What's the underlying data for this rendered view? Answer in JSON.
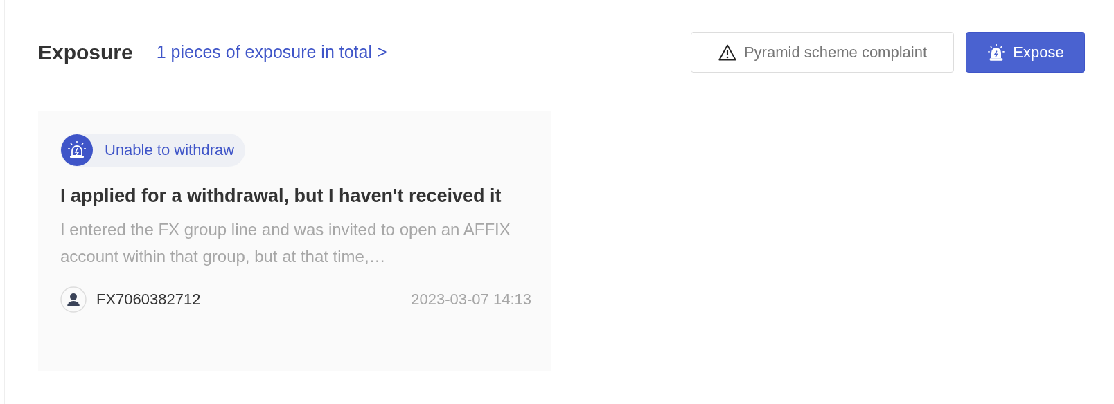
{
  "header": {
    "title": "Exposure",
    "total_link": "1 pieces of exposure in total",
    "link_arrow": ">"
  },
  "buttons": [
    {
      "kind": "outline",
      "label": "Pyramid scheme complaint"
    },
    {
      "kind": "primary",
      "label": "Expose"
    }
  ],
  "cards": [
    {
      "tag": "Unable to withdraw",
      "title": "I applied for a withdrawal, but I haven't received it",
      "excerpt": "I entered the FX group line and was invited to open an AFFIX account within that group, but at that time,…",
      "user": "FX7060382712",
      "time": "2023-03-07 14:13"
    }
  ]
}
